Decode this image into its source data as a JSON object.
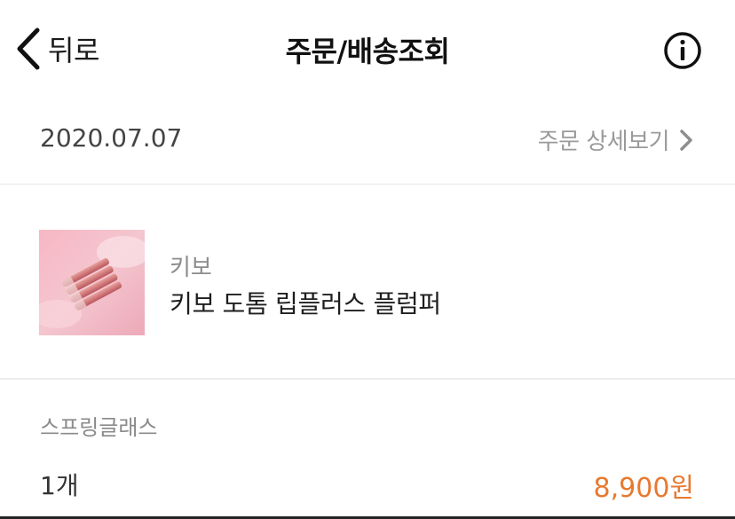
{
  "header": {
    "back_label": "뒤로",
    "title": "주문/배송조회"
  },
  "order": {
    "date": "2020.07.07",
    "detail_link": "주문 상세보기"
  },
  "product": {
    "brand": "키보",
    "name": "키보 도톰 립플러스 플럼퍼"
  },
  "option": {
    "name": "스프링글래스",
    "quantity": "1개",
    "price": "8,900원"
  },
  "colors": {
    "price": "#e8792e",
    "muted_text": "#8c8c8c",
    "divider": "#e6e6e6"
  }
}
